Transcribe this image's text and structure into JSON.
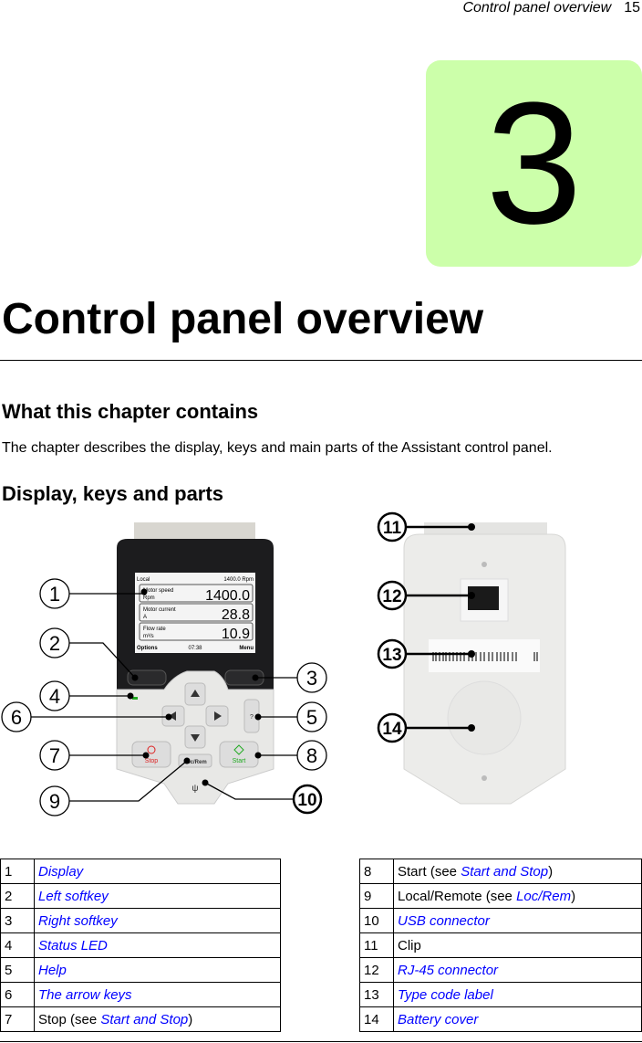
{
  "running_header": {
    "title": "Control panel overview",
    "page": "15"
  },
  "chapter_number": "3",
  "title": "Control panel overview",
  "section1": {
    "heading": "What this chapter contains",
    "text": "The chapter describes the display, keys and main parts of the Assistant control panel."
  },
  "section2": {
    "heading": "Display, keys and parts"
  },
  "panel_screen": {
    "mode": "Local",
    "ref": "1400.0 Rpm",
    "rows": [
      {
        "name": "Motor speed",
        "unit": "Rpm",
        "value": "1400.0"
      },
      {
        "name": "Motor current",
        "unit": "A",
        "value": "28.8"
      },
      {
        "name": "Flow rate",
        "unit": "m³/s",
        "value": "10.9"
      }
    ],
    "left_soft": "Options",
    "time": "07:38",
    "right_soft": "Menu"
  },
  "panel_keys": {
    "stop": "Stop",
    "start": "Start",
    "locrem": "Loc/Rem",
    "help": "?"
  },
  "callouts": [
    "1",
    "2",
    "3",
    "4",
    "5",
    "6",
    "7",
    "8",
    "9",
    "10",
    "11",
    "12",
    "13",
    "14"
  ],
  "legend_left": [
    {
      "n": "1",
      "pre": "",
      "link": "Display",
      "post": ""
    },
    {
      "n": "2",
      "pre": "",
      "link": "Left softkey",
      "post": ""
    },
    {
      "n": "3",
      "pre": "",
      "link": "Right softkey",
      "post": ""
    },
    {
      "n": "4",
      "pre": "",
      "link": "Status LED",
      "post": ""
    },
    {
      "n": "5",
      "pre": "",
      "link": "Help",
      "post": ""
    },
    {
      "n": "6",
      "pre": "",
      "link": "The arrow keys",
      "post": ""
    },
    {
      "n": "7",
      "pre": "Stop (see ",
      "link": "Start and Stop",
      "post": ")"
    }
  ],
  "legend_right": [
    {
      "n": "8",
      "pre": "Start (see ",
      "link": "Start and Stop",
      "post": ")"
    },
    {
      "n": "9",
      "pre": "Local/Remote (see ",
      "link": "Loc/Rem",
      "post": ")"
    },
    {
      "n": "10",
      "pre": "",
      "link": "USB connector",
      "post": ""
    },
    {
      "n": "11",
      "pre": "Clip",
      "link": "",
      "post": ""
    },
    {
      "n": "12",
      "pre": "",
      "link": "RJ-45 connector",
      "post": ""
    },
    {
      "n": "13",
      "pre": "",
      "link": "Type code label",
      "post": ""
    },
    {
      "n": "14",
      "pre": "",
      "link": "Battery cover",
      "post": ""
    }
  ],
  "colors": {
    "chapter_box": "#ccffaa",
    "link": "#0000ff"
  }
}
